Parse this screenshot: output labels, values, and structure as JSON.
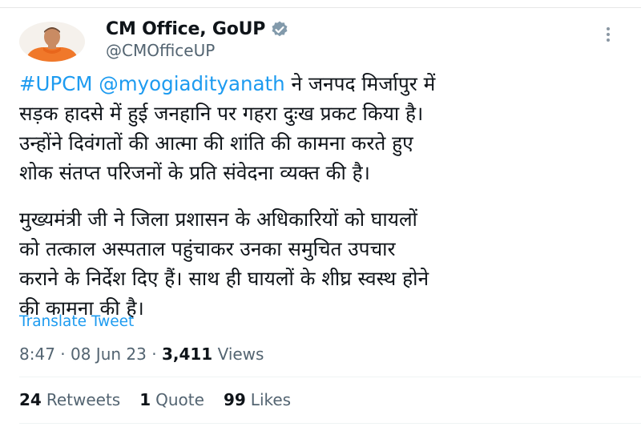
{
  "author": {
    "display_name": "CM Office, GoUP",
    "handle": "@CMOfficeUP",
    "verified_icon": "verified-badge-icon",
    "avatar": "profile-avatar"
  },
  "tweet": {
    "hashtag": "#UPCM",
    "mention": "@myogiadityanath",
    "paragraph1_rest": " ने जनपद मिर्जापुर में\nसड़क हादसे में हुई जनहानि पर गहरा दुःख प्रकट किया है।\nउन्होंने दिवंगतों की आत्मा की शांति की कामना करते हुए\nशोक संतप्त परिजनों के प्रति संवेदना व्यक्त की है।",
    "paragraph2": "मुख्यमंत्री जी ने जिला प्रशासन के अधिकारियों को घायलों\nको तत्काल अस्पताल पहुंचाकर उनका समुचित उपचार\nकराने के निर्देश दिए हैं। साथ ही घायलों के शीघ्र स्वस्थ होने\nकी कामना की है।",
    "translate_label": "Translate Tweet"
  },
  "meta": {
    "time": "8:47",
    "separator": " · ",
    "date": "08 Jun 23",
    "views_count": "3,411",
    "views_label": " Views"
  },
  "stats": {
    "retweets_count": "24",
    "retweets_label": "Retweets",
    "quotes_count": "1",
    "quotes_label": "Quote",
    "likes_count": "99",
    "likes_label": "Likes"
  },
  "colors": {
    "link": "#1d9bf0",
    "secondary_text": "#536471",
    "primary_text": "#0f1419"
  }
}
